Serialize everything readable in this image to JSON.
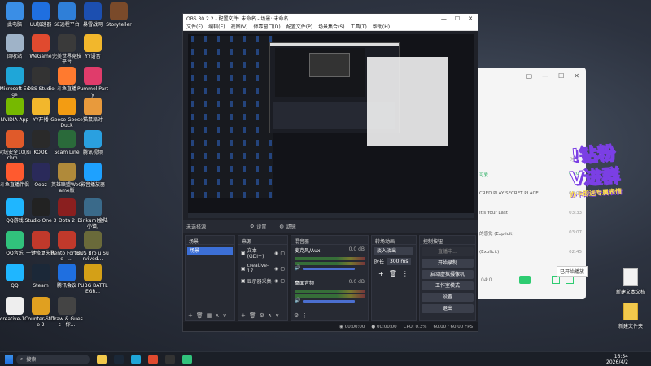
{
  "desktop": {
    "left_icons": [
      {
        "label": "此电脑",
        "color": "#3a8ee6"
      },
      {
        "label": "UU加速器",
        "color": "#1f6fe0"
      },
      {
        "label": "SE远程平台",
        "color": "#2f7fd8"
      },
      {
        "label": "暴雪战网",
        "color": "#1c4fb0"
      },
      {
        "label": "Storyteller",
        "color": "#7a4a2a"
      },
      {
        "label": "回收站",
        "color": "#9fb3c8"
      },
      {
        "label": "WeGame",
        "color": "#e04a2f"
      },
      {
        "label": "完美世界竞技平台",
        "color": "#3a3a3a"
      },
      {
        "label": "YY语音",
        "color": "#f2b72c"
      },
      {
        "label": "Microsoft Edge",
        "color": "#1fa6d8"
      },
      {
        "label": "OBS Studio",
        "color": "#333"
      },
      {
        "label": "斗鱼直播",
        "color": "#ff7a2f"
      },
      {
        "label": "Pummel Party",
        "color": "#e03c6b"
      },
      {
        "label": "NVIDIA App",
        "color": "#76b900"
      },
      {
        "label": "YY开播",
        "color": "#f2b72c"
      },
      {
        "label": "Goose Goose Duck",
        "color": "#f39c12"
      },
      {
        "label": "猫鼠派对",
        "color": "#e89a3c"
      },
      {
        "label": "火绒安全10(Richm...",
        "color": "#e05a2a"
      },
      {
        "label": "KOOK",
        "color": "#2a2a2a"
      },
      {
        "label": "Scam Line",
        "color": "#2a6a3a"
      },
      {
        "label": "腾讯视频",
        "color": "#2aa0e0"
      },
      {
        "label": "斗鱼直播伴侣",
        "color": "#ff5a2f"
      },
      {
        "label": "Oopz",
        "color": "#2a2a5a"
      },
      {
        "label": "英雄联盟WeGame版",
        "color": "#b08a3a"
      },
      {
        "label": "影音播放器",
        "color": "#1ea1ff"
      },
      {
        "label": "QQ游戏",
        "color": "#1fb6ff"
      },
      {
        "label": "Studio One 3",
        "color": "#222"
      },
      {
        "label": "Dota 2",
        "color": "#8a1f1f"
      },
      {
        "label": "Dinkum(金陆小镇)",
        "color": "#3a6a8a"
      },
      {
        "label": "QQ音乐",
        "color": "#31c27c"
      },
      {
        "label": "一键修复失败",
        "color": "#c0392b"
      },
      {
        "label": "Rento Fortune - ...",
        "color": "#c0392b"
      },
      {
        "label": "BUS Bro u Survived...",
        "color": "#6a6a3a"
      },
      {
        "label": "QQ",
        "color": "#1fb6ff"
      },
      {
        "label": "Steam",
        "color": "#1b2838"
      },
      {
        "label": "腾讯会议",
        "color": "#1f6fe0"
      },
      {
        "label": "PUBG BATTLEGR...",
        "color": "#d4a017"
      },
      {
        "label": "creative-1...",
        "color": "#eee"
      },
      {
        "label": "Counter-Strike 2",
        "color": "#e0a020"
      },
      {
        "label": "Draw & Guess - 你...",
        "color": "#444"
      }
    ],
    "right_icons": [
      {
        "label": "新建文本文档"
      },
      {
        "label": "新建文件夹"
      }
    ]
  },
  "music": {
    "tracks": [
      {
        "name": "可爱",
        "time": "04:08",
        "highlight": true
      },
      {
        "name": "CRED PLAY SECRET PLACE",
        "time": "03:08"
      },
      {
        "name": "It's Your Last",
        "time": "03:33"
      },
      {
        "name": "的感觉 (Explicit)",
        "time": "03:07"
      },
      {
        "name": "(Explicit)",
        "time": "02:45"
      }
    ],
    "header_time": "时长",
    "bottom_time": "04:0",
    "sticker_line1": "!钻粉",
    "sticker_line2": "V进群",
    "sticker_line3": "办卡即送专属表情",
    "tooltip": "已开始播放"
  },
  "obs": {
    "title": "OBS 30.2.2 - 配置文件: 未命名 - 场景: 未命名",
    "menu": [
      "文件(F)",
      "编辑(E)",
      "视图(V)",
      "停靠窗口(D)",
      "配置文件(P)",
      "场景集合(S)",
      "工具(T)",
      "帮助(H)"
    ],
    "srcbar": {
      "no_source": "未选择源",
      "settings": "设置",
      "filters": "滤镜"
    },
    "scenes": {
      "title": "场景",
      "items": [
        "场景"
      ]
    },
    "sources": {
      "title": "来源",
      "items": [
        "文本 (GDI+)",
        "creative-17",
        "显示器采集"
      ]
    },
    "mixer": {
      "title": "混音器",
      "channels": [
        {
          "name": "麦克风/Aux",
          "db": "0.0 dB"
        },
        {
          "name": "桌面音频",
          "db": "0.0 dB"
        }
      ]
    },
    "transitions": {
      "title": "转场动画",
      "type": "淡入淡出",
      "duration_label": "时长",
      "duration": "300 ms"
    },
    "controls": {
      "title": "控制按钮",
      "buttons": [
        "直播中...",
        "开始录制",
        "启动虚拟摄像机",
        "工作室模式",
        "设置",
        "退出"
      ]
    },
    "status": {
      "stream": "00:00:00",
      "rec": "00:00:00",
      "cpu": "CPU: 0.3%",
      "fps": "60.00 / 60.00 FPS"
    }
  },
  "taskbar": {
    "search": "搜索",
    "time": "16:54",
    "date": "2026/4/2"
  }
}
